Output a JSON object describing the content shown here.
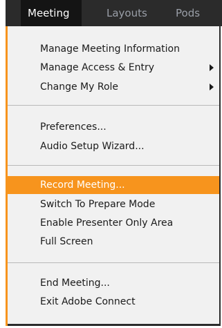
{
  "menubar": {
    "items": [
      {
        "label": "Meeting",
        "active": true
      },
      {
        "label": "Layouts",
        "active": false
      },
      {
        "label": "Pods",
        "active": false
      }
    ]
  },
  "menu": {
    "groups": [
      {
        "items": [
          {
            "label": "Manage Meeting Information",
            "submenu": false
          },
          {
            "label": "Manage Access & Entry",
            "submenu": true
          },
          {
            "label": "Change My Role",
            "submenu": true
          }
        ]
      },
      {
        "items": [
          {
            "label": "Preferences...",
            "submenu": false
          },
          {
            "label": "Audio Setup Wizard...",
            "submenu": false
          }
        ]
      },
      {
        "items": [
          {
            "label": "Record Meeting...",
            "submenu": false,
            "highlighted": true
          },
          {
            "label": "Switch To Prepare Mode",
            "submenu": false
          },
          {
            "label": "Enable Presenter Only Area",
            "submenu": false
          },
          {
            "label": "Full Screen",
            "submenu": false
          }
        ]
      },
      {
        "items": [
          {
            "label": "End Meeting...",
            "submenu": false
          },
          {
            "label": "Exit Adobe Connect",
            "submenu": false
          }
        ]
      }
    ]
  },
  "colors": {
    "accent": "#f7941d",
    "menubar_bg": "#2b2b2b",
    "menu_bg": "#f1f1f1",
    "separator": "#b8b8b8"
  },
  "icons": {
    "submenu": "chevron-right-icon"
  }
}
